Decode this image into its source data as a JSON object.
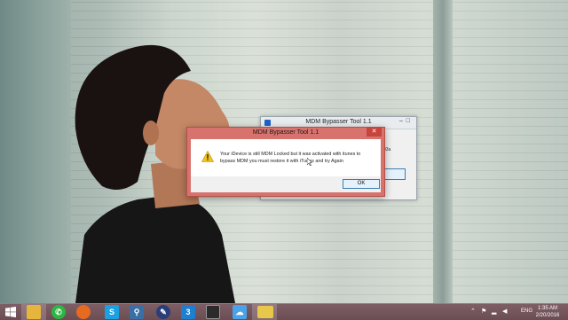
{
  "background_window": {
    "title": "MDM Bypasser Tool 1.1",
    "partial_text": "03a"
  },
  "dialog": {
    "title": "MDM Bypasser Tool 1.1",
    "close_glyph": "✕",
    "message_line1": "Your iDevice is still MDM Locked but it was activated with itunes to",
    "message_line2": "bypass MDM you must restore it with iTunes and try Again",
    "ok_label": "OK"
  },
  "taskbar": {
    "apps": [
      {
        "name": "file-explorer",
        "glyph": ""
      },
      {
        "name": "whatsapp",
        "glyph": "✆"
      },
      {
        "name": "firefox",
        "glyph": ""
      },
      {
        "name": "skype",
        "glyph": "S"
      },
      {
        "name": "search-tool",
        "glyph": "⚲"
      },
      {
        "name": "app-feather",
        "glyph": "✎"
      },
      {
        "name": "app-3",
        "glyph": "3"
      },
      {
        "name": "video-editor",
        "glyph": ""
      },
      {
        "name": "icloud",
        "glyph": "☁"
      },
      {
        "name": "folder-app",
        "glyph": ""
      }
    ],
    "language": "ENG",
    "time": "1:35 AM",
    "date": "2/20/2016"
  },
  "colors": {
    "dialog_frame": "#d7726c",
    "taskbar": "#6f5259",
    "accent_blue": "#1e62c8"
  }
}
